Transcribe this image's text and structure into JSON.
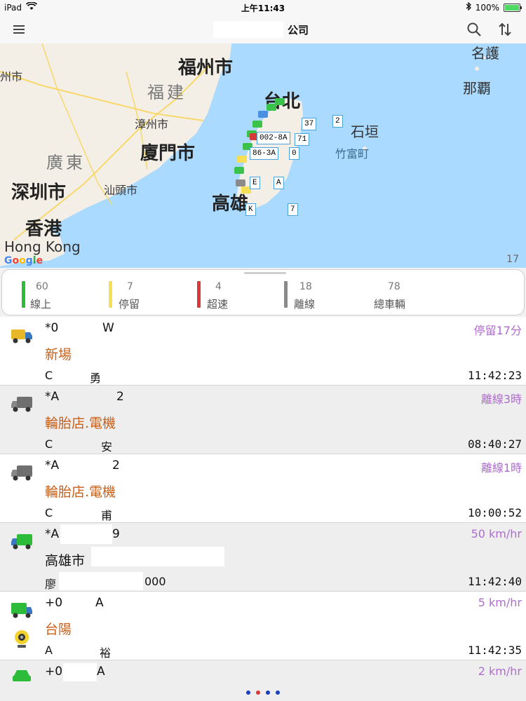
{
  "status_bar": {
    "device": "iPad",
    "time": "上午11:43",
    "battery": "100%"
  },
  "nav": {
    "title_suffix": "公司"
  },
  "map": {
    "labels": {
      "fuzhou": "福州市",
      "fujian": "福建",
      "zhangzhou": "漳州市",
      "xiamen": "廈門市",
      "guangdong": "廣東",
      "shantou": "汕頭市",
      "shenzhen": "深圳市",
      "hongkong_cn": "香港",
      "hongkong_en": "Hong Kong",
      "taipei": "台北",
      "kaohsiung": "高雄",
      "ishigaki": "石垣",
      "taketomi": "竹富町",
      "nago": "名護",
      "naha": "那覇",
      "meizhou": "州市",
      "zoom": "17"
    },
    "google": [
      "G",
      "o",
      "o",
      "g",
      "l",
      "e"
    ],
    "tags": [
      "37",
      "2",
      "002-8A",
      "71",
      "86-3A",
      "0",
      "E",
      "A",
      "K",
      "7"
    ]
  },
  "legend": [
    {
      "count": "60",
      "label": "線上",
      "color": "#2dbb3a"
    },
    {
      "count": "7",
      "label": "停留",
      "color": "#f4df55"
    },
    {
      "count": "4",
      "label": "超速",
      "color": "#d83a3a"
    },
    {
      "count": "18",
      "label": "離線",
      "color": "#8a8a8a"
    },
    {
      "count": "78",
      "label": "總車輛",
      "color": ""
    }
  ],
  "vehicles": [
    {
      "plate_a": "*0",
      "plate_b": "W",
      "location": "新場",
      "driver_a": "C",
      "driver_b": "勇",
      "status": "停留17分",
      "time": "11:42:23",
      "icon": "yellow-truck-icon"
    },
    {
      "plate_a": "*A",
      "plate_b": "2",
      "location": "輪胎店.電機",
      "driver_a": "C",
      "driver_b": "安",
      "status": "離線3時",
      "time": "08:40:27",
      "icon": "gray-truck-icon"
    },
    {
      "plate_a": "*A",
      "plate_b": "2",
      "location": "輪胎店.電機",
      "driver_a": "C",
      "driver_b": "甫",
      "status": "離線1時",
      "time": "10:00:52",
      "icon": "gray-truck-icon"
    },
    {
      "plate_a": "*A",
      "plate_b": "9",
      "location": "高雄市",
      "driver_a": "廖",
      "driver_b": "000",
      "status": "50 km/hr",
      "time": "11:42:40",
      "icon": "green-truck-icon"
    },
    {
      "plate_a": "+0",
      "plate_b": "A",
      "location": "台陽",
      "driver_a": "A",
      "driver_b": "裕",
      "status": "5 km/hr",
      "time": "11:42:35",
      "icon": "green-truck-icon"
    },
    {
      "plate_a": "+0",
      "plate_b": "A",
      "location": "",
      "driver_a": "",
      "driver_b": "",
      "status": "2 km/hr",
      "time": "",
      "icon": "green-car-icon"
    }
  ]
}
